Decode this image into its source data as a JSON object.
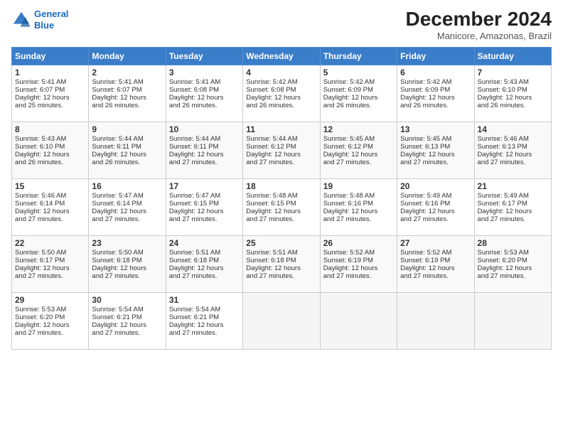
{
  "logo": {
    "line1": "General",
    "line2": "Blue"
  },
  "title": "December 2024",
  "subtitle": "Manicore, Amazonas, Brazil",
  "headers": [
    "Sunday",
    "Monday",
    "Tuesday",
    "Wednesday",
    "Thursday",
    "Friday",
    "Saturday"
  ],
  "weeks": [
    [
      {
        "day": "1",
        "lines": [
          "Sunrise: 5:41 AM",
          "Sunset: 6:07 PM",
          "Daylight: 12 hours",
          "and 25 minutes."
        ]
      },
      {
        "day": "2",
        "lines": [
          "Sunrise: 5:41 AM",
          "Sunset: 6:07 PM",
          "Daylight: 12 hours",
          "and 26 minutes."
        ]
      },
      {
        "day": "3",
        "lines": [
          "Sunrise: 5:41 AM",
          "Sunset: 6:08 PM",
          "Daylight: 12 hours",
          "and 26 minutes."
        ]
      },
      {
        "day": "4",
        "lines": [
          "Sunrise: 5:42 AM",
          "Sunset: 6:08 PM",
          "Daylight: 12 hours",
          "and 26 minutes."
        ]
      },
      {
        "day": "5",
        "lines": [
          "Sunrise: 5:42 AM",
          "Sunset: 6:09 PM",
          "Daylight: 12 hours",
          "and 26 minutes."
        ]
      },
      {
        "day": "6",
        "lines": [
          "Sunrise: 5:42 AM",
          "Sunset: 6:09 PM",
          "Daylight: 12 hours",
          "and 26 minutes."
        ]
      },
      {
        "day": "7",
        "lines": [
          "Sunrise: 5:43 AM",
          "Sunset: 6:10 PM",
          "Daylight: 12 hours",
          "and 26 minutes."
        ]
      }
    ],
    [
      {
        "day": "8",
        "lines": [
          "Sunrise: 5:43 AM",
          "Sunset: 6:10 PM",
          "Daylight: 12 hours",
          "and 26 minutes."
        ]
      },
      {
        "day": "9",
        "lines": [
          "Sunrise: 5:44 AM",
          "Sunset: 6:11 PM",
          "Daylight: 12 hours",
          "and 26 minutes."
        ]
      },
      {
        "day": "10",
        "lines": [
          "Sunrise: 5:44 AM",
          "Sunset: 6:11 PM",
          "Daylight: 12 hours",
          "and 27 minutes."
        ]
      },
      {
        "day": "11",
        "lines": [
          "Sunrise: 5:44 AM",
          "Sunset: 6:12 PM",
          "Daylight: 12 hours",
          "and 27 minutes."
        ]
      },
      {
        "day": "12",
        "lines": [
          "Sunrise: 5:45 AM",
          "Sunset: 6:12 PM",
          "Daylight: 12 hours",
          "and 27 minutes."
        ]
      },
      {
        "day": "13",
        "lines": [
          "Sunrise: 5:45 AM",
          "Sunset: 6:13 PM",
          "Daylight: 12 hours",
          "and 27 minutes."
        ]
      },
      {
        "day": "14",
        "lines": [
          "Sunrise: 5:46 AM",
          "Sunset: 6:13 PM",
          "Daylight: 12 hours",
          "and 27 minutes."
        ]
      }
    ],
    [
      {
        "day": "15",
        "lines": [
          "Sunrise: 5:46 AM",
          "Sunset: 6:14 PM",
          "Daylight: 12 hours",
          "and 27 minutes."
        ]
      },
      {
        "day": "16",
        "lines": [
          "Sunrise: 5:47 AM",
          "Sunset: 6:14 PM",
          "Daylight: 12 hours",
          "and 27 minutes."
        ]
      },
      {
        "day": "17",
        "lines": [
          "Sunrise: 5:47 AM",
          "Sunset: 6:15 PM",
          "Daylight: 12 hours",
          "and 27 minutes."
        ]
      },
      {
        "day": "18",
        "lines": [
          "Sunrise: 5:48 AM",
          "Sunset: 6:15 PM",
          "Daylight: 12 hours",
          "and 27 minutes."
        ]
      },
      {
        "day": "19",
        "lines": [
          "Sunrise: 5:48 AM",
          "Sunset: 6:16 PM",
          "Daylight: 12 hours",
          "and 27 minutes."
        ]
      },
      {
        "day": "20",
        "lines": [
          "Sunrise: 5:49 AM",
          "Sunset: 6:16 PM",
          "Daylight: 12 hours",
          "and 27 minutes."
        ]
      },
      {
        "day": "21",
        "lines": [
          "Sunrise: 5:49 AM",
          "Sunset: 6:17 PM",
          "Daylight: 12 hours",
          "and 27 minutes."
        ]
      }
    ],
    [
      {
        "day": "22",
        "lines": [
          "Sunrise: 5:50 AM",
          "Sunset: 6:17 PM",
          "Daylight: 12 hours",
          "and 27 minutes."
        ]
      },
      {
        "day": "23",
        "lines": [
          "Sunrise: 5:50 AM",
          "Sunset: 6:18 PM",
          "Daylight: 12 hours",
          "and 27 minutes."
        ]
      },
      {
        "day": "24",
        "lines": [
          "Sunrise: 5:51 AM",
          "Sunset: 6:18 PM",
          "Daylight: 12 hours",
          "and 27 minutes."
        ]
      },
      {
        "day": "25",
        "lines": [
          "Sunrise: 5:51 AM",
          "Sunset: 6:18 PM",
          "Daylight: 12 hours",
          "and 27 minutes."
        ]
      },
      {
        "day": "26",
        "lines": [
          "Sunrise: 5:52 AM",
          "Sunset: 6:19 PM",
          "Daylight: 12 hours",
          "and 27 minutes."
        ]
      },
      {
        "day": "27",
        "lines": [
          "Sunrise: 5:52 AM",
          "Sunset: 6:19 PM",
          "Daylight: 12 hours",
          "and 27 minutes."
        ]
      },
      {
        "day": "28",
        "lines": [
          "Sunrise: 5:53 AM",
          "Sunset: 6:20 PM",
          "Daylight: 12 hours",
          "and 27 minutes."
        ]
      }
    ],
    [
      {
        "day": "29",
        "lines": [
          "Sunrise: 5:53 AM",
          "Sunset: 6:20 PM",
          "Daylight: 12 hours",
          "and 27 minutes."
        ]
      },
      {
        "day": "30",
        "lines": [
          "Sunrise: 5:54 AM",
          "Sunset: 6:21 PM",
          "Daylight: 12 hours",
          "and 27 minutes."
        ]
      },
      {
        "day": "31",
        "lines": [
          "Sunrise: 5:54 AM",
          "Sunset: 6:21 PM",
          "Daylight: 12 hours",
          "and 27 minutes."
        ]
      },
      null,
      null,
      null,
      null
    ]
  ]
}
